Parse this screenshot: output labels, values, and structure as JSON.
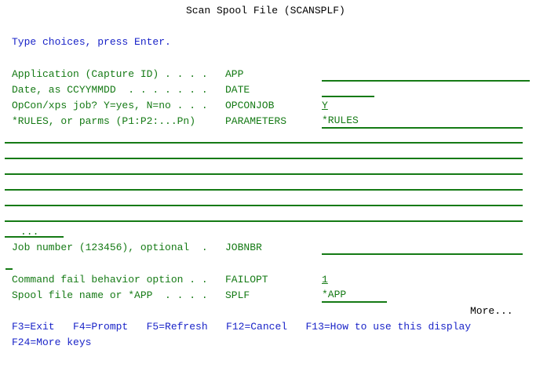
{
  "screen": {
    "title": "Scan Spool File (SCANSPLF)",
    "instructions": "Type choices, press Enter.",
    "more_indicator": "More..."
  },
  "fields": [
    {
      "prompt": "Application (Capture ID) . . . .",
      "keyword": "APP",
      "value": ""
    },
    {
      "prompt": "Date, as CCYYMMDD  . . . . . . .",
      "keyword": "DATE",
      "value": ""
    },
    {
      "prompt": "OpCon/xps job? Y=yes, N=no . . .",
      "keyword": "OPCONJOB",
      "value": "Y"
    },
    {
      "prompt": "*RULES, or parms (P1:P2:...Pn)",
      "keyword": "PARAMETERS",
      "value": "*RULES"
    },
    {
      "prompt": "Job number (123456), optional  .",
      "keyword": "JOBNBR",
      "value": ""
    },
    {
      "prompt": "Command fail behavior option . .",
      "keyword": "FAILOPT",
      "value": "1"
    },
    {
      "prompt": "Spool file name or *APP  . . . .",
      "keyword": "SPLF",
      "value": "*APP"
    }
  ],
  "continuation_marker": "...",
  "function_keys": {
    "line1": "F3=Exit   F4=Prompt   F5=Refresh   F12=Cancel   F13=How to use this display",
    "line2": "F24=More keys"
  }
}
